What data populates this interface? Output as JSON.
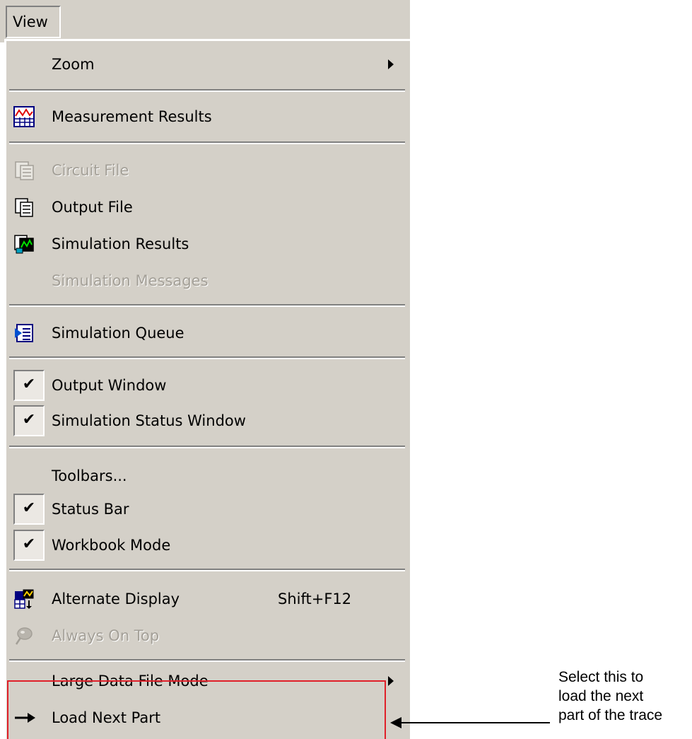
{
  "menubar": {
    "view_label": "View"
  },
  "menu": {
    "zoom": "Zoom",
    "measurement_results": "Measurement Results",
    "circuit_file": "Circuit File",
    "output_file": "Output File",
    "simulation_results": "Simulation Results",
    "simulation_messages": "Simulation Messages",
    "simulation_queue": "Simulation Queue",
    "output_window": "Output Window",
    "simulation_status_window": "Simulation Status Window",
    "toolbars": "Toolbars...",
    "status_bar": "Status Bar",
    "workbook_mode": "Workbook Mode",
    "alternate_display": "Alternate Display",
    "alternate_display_shortcut": "Shift+F12",
    "always_on_top": "Always On Top",
    "large_data_file_mode": "Large Data File Mode",
    "load_next_part": "Load Next Part"
  },
  "checked_items": [
    "Output Window",
    "Simulation Status Window",
    "Status Bar",
    "Workbook Mode"
  ],
  "disabled_items": [
    "Circuit File",
    "Simulation Messages",
    "Always On Top"
  ],
  "icons": {
    "measurement_results": "waveform-grid-icon",
    "circuit_file": "circuit-file-icon",
    "output_file": "output-file-icon",
    "simulation_results": "simulation-results-icon",
    "simulation_queue": "queue-list-icon",
    "alternate_display": "alternate-display-icon",
    "always_on_top": "pin-icon",
    "load_next_part": "right-arrow-icon"
  },
  "annotation": {
    "line1": "Select this to",
    "line2": "load the next",
    "line3": "part of the trace"
  },
  "colors": {
    "menu_bg": "#d4d0c8",
    "disabled_text": "#a39f97",
    "highlight_box": "#e0202a"
  }
}
